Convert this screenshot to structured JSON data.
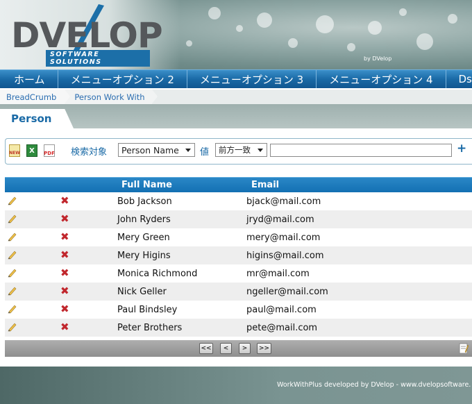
{
  "header": {
    "logo_text": "DVELOP",
    "logo_subtitle": "SOFTWARE  SOLUTIONS",
    "small_brand": "by DVelop"
  },
  "nav": {
    "items": [
      {
        "label": "ホーム"
      },
      {
        "label": "メニューオプション 2"
      },
      {
        "label": "メニューオプション 3"
      },
      {
        "label": "メニューオプション 4"
      },
      {
        "label": "Ds"
      }
    ]
  },
  "breadcrumb": {
    "items": [
      {
        "label": "BreadCrumb"
      },
      {
        "label": "Person Work With"
      }
    ]
  },
  "tab": {
    "label": "Person"
  },
  "filter": {
    "new_icon_text": "NEW",
    "xls_icon_text": "X",
    "pdf_icon_text": "PDF",
    "search_target_label": "検索対象",
    "search_target_value": "Person Name",
    "value_label": "値",
    "match_value": "前方一致",
    "text_value": "",
    "add_label": "+"
  },
  "grid": {
    "columns": {
      "full_name": "Full Name",
      "email": "Email"
    },
    "rows": [
      {
        "name": "Bob Jackson",
        "email": "bjack@mail.com"
      },
      {
        "name": "John Ryders",
        "email": "jryd@mail.com"
      },
      {
        "name": "Mery Green",
        "email": "mery@mail.com"
      },
      {
        "name": "Mery Higins",
        "email": "higins@mail.com"
      },
      {
        "name": "Monica Richmond",
        "email": "mr@mail.com"
      },
      {
        "name": "Nick Geller",
        "email": "ngeller@mail.com"
      },
      {
        "name": "Paul Bindsley",
        "email": "paul@mail.com"
      },
      {
        "name": "Peter Brothers",
        "email": "pete@mail.com"
      }
    ],
    "delete_glyph": "✖"
  },
  "pager": {
    "first": "<<",
    "prev": "<",
    "next": ">",
    "last": ">>"
  },
  "footer": {
    "text": "WorkWithPlus developed by DVelop - www.dvelopsoftware."
  },
  "colors": {
    "accent": "#1a6aa6",
    "delete": "#c1272d"
  }
}
